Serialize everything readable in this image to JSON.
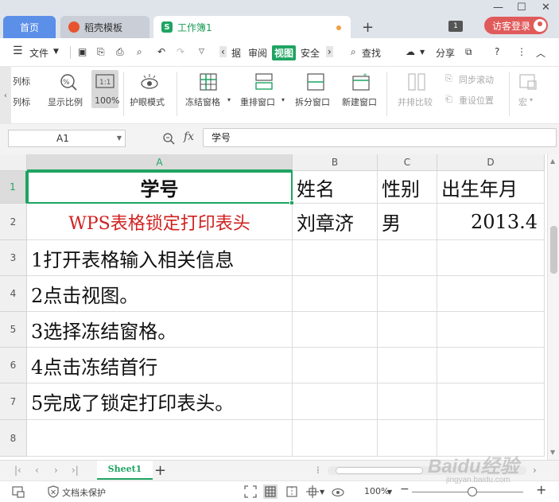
{
  "titlebar": {
    "tabs": [
      {
        "label": "首页"
      },
      {
        "label": "稻壳模板"
      },
      {
        "label": "工作簿1"
      }
    ],
    "window_count": "1",
    "login_label": "访客登录"
  },
  "menu": {
    "file": "文件",
    "tabs_visible": [
      "据",
      "审阅",
      "视图",
      "安全"
    ],
    "active_tab": "视图",
    "search": "查找",
    "share": "分享"
  },
  "ribbon": {
    "left_labels": [
      "列标",
      "列标"
    ],
    "zoom_ratio_label": "显示比例",
    "zoom_100_label": "100%",
    "eye_mode": "护眼模式",
    "freeze": "冻结窗格",
    "rearrange": "重排窗口",
    "split": "拆分窗口",
    "new_window": "新建窗口",
    "side_compare": "并排比较",
    "sync_scroll": "同步滚动",
    "reset_pos": "重设位置",
    "macro": "宏"
  },
  "formula": {
    "name_box": "A1",
    "fx": "fx",
    "value": "学号"
  },
  "grid": {
    "columns": [
      "A",
      "B",
      "C",
      "D"
    ],
    "rows": [
      "1",
      "2",
      "3",
      "4",
      "5",
      "6",
      "7",
      "8"
    ],
    "cells": {
      "A1": "学号",
      "B1": "姓名",
      "C1": "性别",
      "D1": "出生年月",
      "A2": "WPS表格锁定打印表头",
      "B2": "刘章济",
      "C2": "男",
      "D2": "2013.4",
      "A3": "1打开表格输入相关信息",
      "A4": "2点击视图。",
      "A5": "3选择冻结窗格。",
      "A6": "4点击冻结首行",
      "A7": "5完成了锁定打印表头。"
    }
  },
  "sheets": {
    "active": "Sheet1"
  },
  "status": {
    "doc_protect": "文档未保护",
    "zoom": "100%"
  },
  "watermark": {
    "main": "Baidu经验",
    "sub": "jingyan.baidu.com"
  },
  "colors": {
    "accent": "#1fa463",
    "home_tab": "#5b8fe8",
    "login": "#e05a5a",
    "red_text": "#d02020"
  }
}
